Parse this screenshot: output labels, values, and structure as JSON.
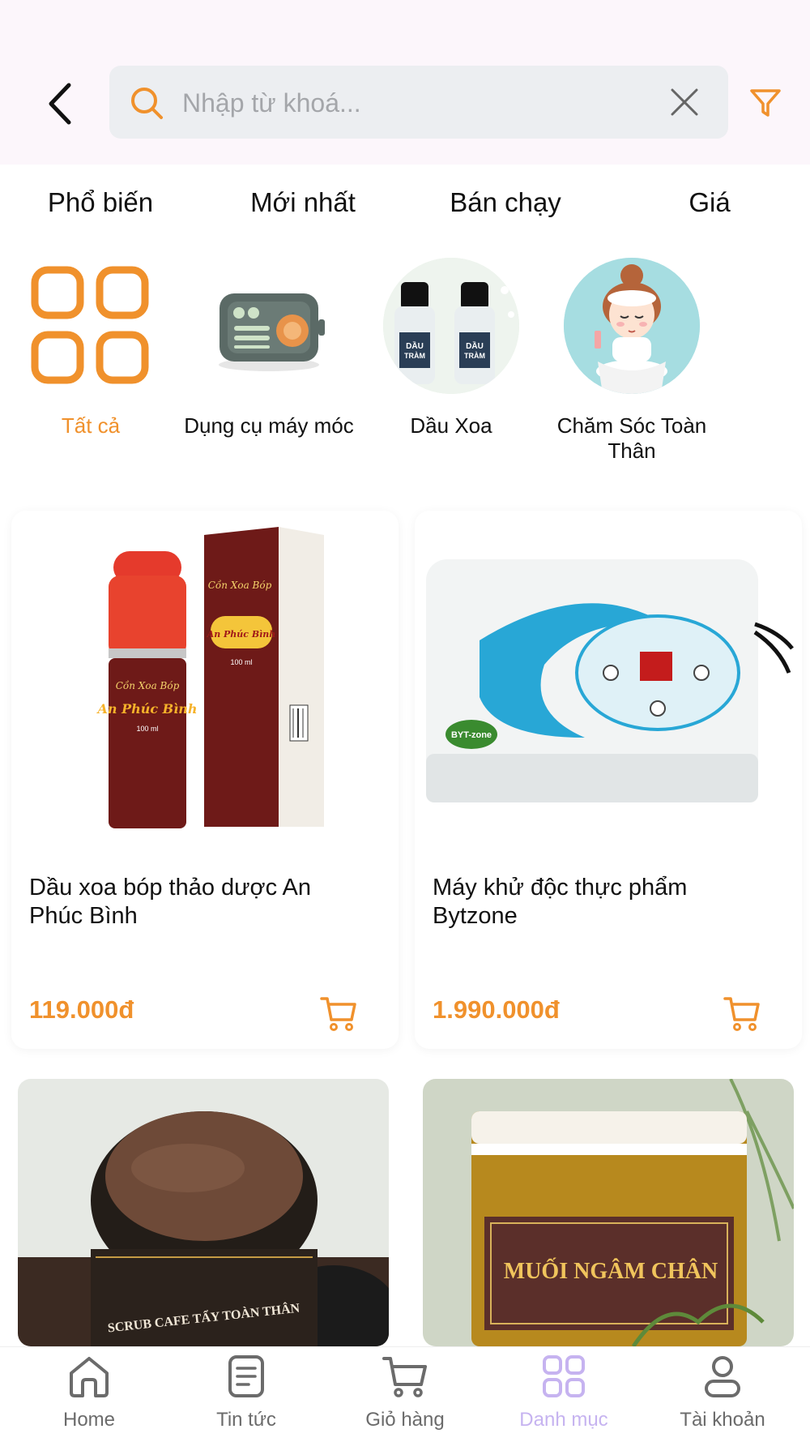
{
  "search": {
    "placeholder": "Nhập từ khoá...",
    "value": ""
  },
  "sort_tabs": [
    "Phổ biến",
    "Mới nhất",
    "Bán chạy",
    "Giá"
  ],
  "categories": [
    {
      "label": "Tất cả",
      "active": true,
      "icon": "grid-icon"
    },
    {
      "label": "Dụng cụ máy móc",
      "active": false,
      "icon": "radio-device-icon"
    },
    {
      "label": "Dầu Xoa",
      "active": false,
      "icon": "oil-bottles-icon"
    },
    {
      "label": "Chăm Sóc Toàn Thân",
      "active": false,
      "icon": "face-care-icon"
    }
  ],
  "products": [
    {
      "name": "Dầu xoa bóp thảo dược An Phúc Bình",
      "price": "119.000đ",
      "image_text": "An Phúc Bình",
      "image_subtext": "Cồn Xoa Bóp",
      "volume": "100 ml"
    },
    {
      "name": "Máy khử độc thực phẩm Bytzone",
      "price": "1.990.000đ",
      "image_text": "BYT-zone"
    }
  ],
  "partial_products": [
    {
      "image_text": "SCRUB CAFE TẨY TOÀN THÂN"
    },
    {
      "image_text": "MUỐI NGÂM CHÂN"
    }
  ],
  "bottom_nav": [
    {
      "label": "Home",
      "icon": "home-icon",
      "active": false
    },
    {
      "label": "Tin tức",
      "icon": "news-icon",
      "active": false
    },
    {
      "label": "Giỏ hàng",
      "icon": "cart-icon",
      "active": false
    },
    {
      "label": "Danh mục",
      "icon": "category-icon",
      "active": true
    },
    {
      "label": "Tài khoản",
      "icon": "account-icon",
      "active": false
    }
  ],
  "colors": {
    "accent": "#f0912c",
    "nav_active": "#c6b3f0",
    "header_bg": "#fcf6fb",
    "search_bg": "#eceef1"
  }
}
